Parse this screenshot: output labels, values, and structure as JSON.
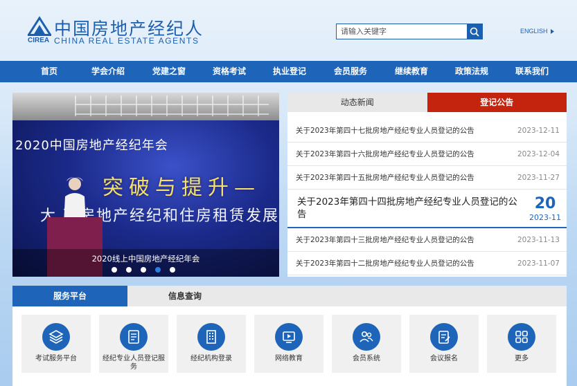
{
  "header": {
    "logo_cn": "中国房地产经纪人",
    "logo_abbr": "CIREA",
    "logo_en": "CHINA REAL ESTATE AGENTS",
    "search_placeholder": "请输入关键字",
    "lang_label": "ENGLISH"
  },
  "nav": {
    "items": [
      "首页",
      "学会介绍",
      "党建之窗",
      "资格考试",
      "执业登记",
      "会员服务",
      "继续教育",
      "政策法规",
      "联系我们"
    ]
  },
  "slider": {
    "headline_year": "2020中国房地产经纪年会",
    "headline_big": "突破与提升—",
    "headline_sub": "大     下房地产经纪和住房租赁发展",
    "caption": "2020线上中国房地产经纪年会",
    "dot_count": 5,
    "active_dot": 3
  },
  "news": {
    "tabs": [
      "动态新闻",
      "登记公告"
    ],
    "rows_top": [
      {
        "title": "关于2023年第四十七批房地产经纪专业人员登记的公告",
        "date": "2023-12-11"
      },
      {
        "title": "关于2023年第四十六批房地产经纪专业人员登记的公告",
        "date": "2023-12-04"
      },
      {
        "title": "关于2023年第四十五批房地产经纪专业人员登记的公告",
        "date": "2023-11-27"
      }
    ],
    "feature": {
      "title": "关于2023年第四十四批房地产经纪专业人员登记的公告",
      "day": "20",
      "year_month": "2023-11"
    },
    "rows_bottom": [
      {
        "title": "关于2023年第四十三批房地产经纪专业人员登记的公告",
        "date": "2023-11-13"
      },
      {
        "title": "关于2023年第四十二批房地产经纪专业人员登记的公告",
        "date": "2023-11-07"
      }
    ]
  },
  "services": {
    "tabs": [
      "服务平台",
      "信息查询"
    ],
    "cards": [
      {
        "label": "考试服务平台",
        "icon": "layers-icon"
      },
      {
        "label": "经纪专业人员登记服务",
        "icon": "certificate-icon"
      },
      {
        "label": "经纪机构登录",
        "icon": "building-icon"
      },
      {
        "label": "网络教育",
        "icon": "online-course-icon"
      },
      {
        "label": "会员系统",
        "icon": "members-icon"
      },
      {
        "label": "会议报名",
        "icon": "registration-icon"
      },
      {
        "label": "更多",
        "icon": "grid-icon"
      }
    ]
  },
  "colors": {
    "brand_blue": "#1e64b8",
    "accent_red": "#c4230d"
  }
}
